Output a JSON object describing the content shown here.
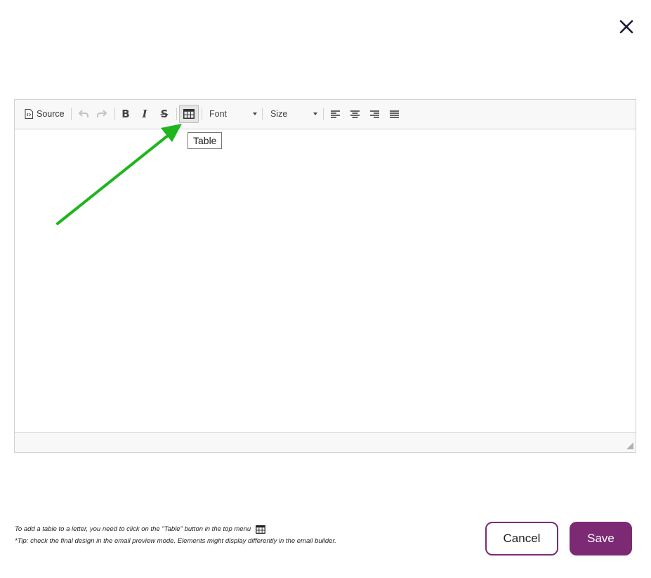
{
  "dialog": {
    "close_icon": "close-icon"
  },
  "toolbar": {
    "source_label": "Source",
    "source_icon": "source-code-icon",
    "undo_icon": "undo-icon",
    "redo_icon": "redo-icon",
    "bold_label": "B",
    "italic_label": "I",
    "strike_label": "S",
    "table_icon": "table-icon",
    "font_label": "Font",
    "size_label": "Size",
    "align_icons": [
      "align-left-icon",
      "align-center-icon",
      "align-right-icon",
      "align-justify-icon"
    ]
  },
  "tooltip": {
    "text": "Table"
  },
  "annotation": {
    "arrow_color": "#1eb51e"
  },
  "footer": {
    "note_line1": "To add a table to a letter, you need to click on the \"Table\" button in the top menu",
    "note_line2": "*Tip: check the final design in the email preview mode. Elements might display differently in the email builder.",
    "cancel_label": "Cancel",
    "save_label": "Save"
  },
  "colors": {
    "accent": "#7b2a73",
    "toolbar_bg": "#f8f8f8",
    "border": "#d1d1d1"
  }
}
